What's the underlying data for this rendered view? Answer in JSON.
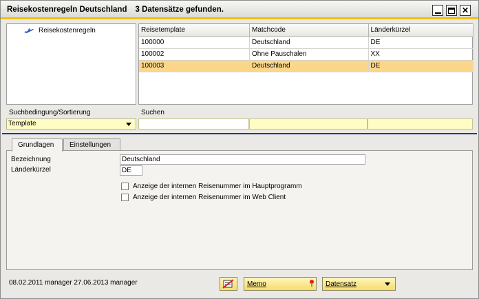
{
  "window": {
    "title": "Reisekostenregeln Deutschland",
    "subtitle": "3 Datensätze gefunden."
  },
  "tree": {
    "item_label": "Reisekostenregeln",
    "item_icon": "airplane-icon"
  },
  "grid": {
    "columns": [
      "Reisetemplate",
      "Matchcode",
      "Länderkürzel"
    ],
    "rows": [
      [
        "100000",
        "Deutschland",
        "DE"
      ],
      [
        "100002",
        "Ohne Pauschalen",
        "XX"
      ],
      [
        "100003",
        "Deutschland",
        "DE"
      ]
    ],
    "selected_row_index": 2,
    "selected_color": "#fcd68a"
  },
  "search": {
    "sort_label": "Suchbedingung/Sortierung",
    "search_label": "Suchen",
    "sort_value": "Template"
  },
  "tabs": [
    {
      "label": "Grundlagen",
      "active": true
    },
    {
      "label": "Einstellungen",
      "active": false
    }
  ],
  "form": {
    "bezeichnung_label": "Bezeichnung",
    "bezeichnung_value": "Deutschland",
    "laenderkuerzel_label": "Länderkürzel",
    "laenderkuerzel_value": "DE",
    "checkbox1_label": "Anzeige der internen Reisenummer im Hauptprogramm",
    "checkbox1_checked": false,
    "checkbox2_label": "Anzeige der internen Reisenummer im Web Client",
    "checkbox2_checked": false
  },
  "footer": {
    "info": "08.02.2011 manager   27.06.2013 manager",
    "memo_label": "Memo",
    "datensatz_label": "Datensatz",
    "delete_icon": "delete-record-icon"
  },
  "colors": {
    "accent_bar": "#f2c200",
    "separator": "#1b3a8c",
    "search_field_bg": "#fffdc4"
  }
}
